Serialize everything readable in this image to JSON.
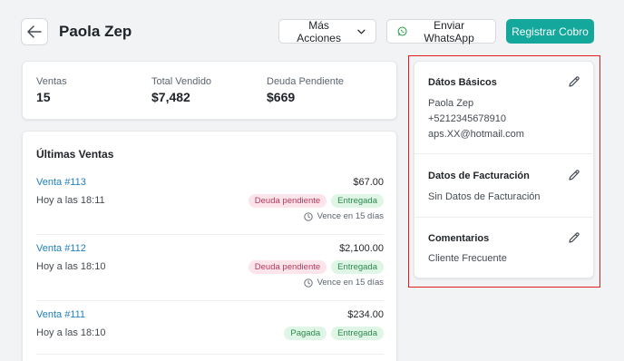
{
  "header": {
    "title": "Paola Zep",
    "more_label": "Más Acciones",
    "whatsapp_label": "Enviar WhatsApp",
    "primary_label": "Registrar Cobro"
  },
  "stats": [
    {
      "label": "Ventas",
      "value": "15"
    },
    {
      "label": "Total Vendido",
      "value": "$7,482"
    },
    {
      "label": "Deuda Pendiente",
      "value": "$669"
    }
  ],
  "sales": {
    "title": "Últimas Ventas",
    "items": [
      {
        "name": "Venta #113",
        "time": "Hoy a las 18:11",
        "amount": "$67.00",
        "badges": [
          "Deuda pendiente",
          "Entregada"
        ],
        "due": "Vence en 15 días"
      },
      {
        "name": "Venta #112",
        "time": "Hoy a las 18:10",
        "amount": "$2,100.00",
        "badges": [
          "Deuda pendiente",
          "Entregada"
        ],
        "due": "Vence en 15 días"
      },
      {
        "name": "Venta #111",
        "time": "Hoy a las 18:10",
        "amount": "$234.00",
        "badges": [
          "Pagada",
          "Entregada"
        ],
        "due": ""
      }
    ]
  },
  "info": {
    "basic": {
      "title": "Dátos Básicos",
      "name": "Paola Zep",
      "phone": "+5212345678910",
      "email": "aps.XX@hotmail.com"
    },
    "billing": {
      "title": "Datos de Facturación",
      "value": "Sin Datos de Facturación"
    },
    "comments": {
      "title": "Comentarios",
      "value": "Cliente Frecuente"
    }
  },
  "colors": {
    "primary": "#14a79b",
    "link": "#1f7fbd",
    "highlight": "#e02020"
  }
}
